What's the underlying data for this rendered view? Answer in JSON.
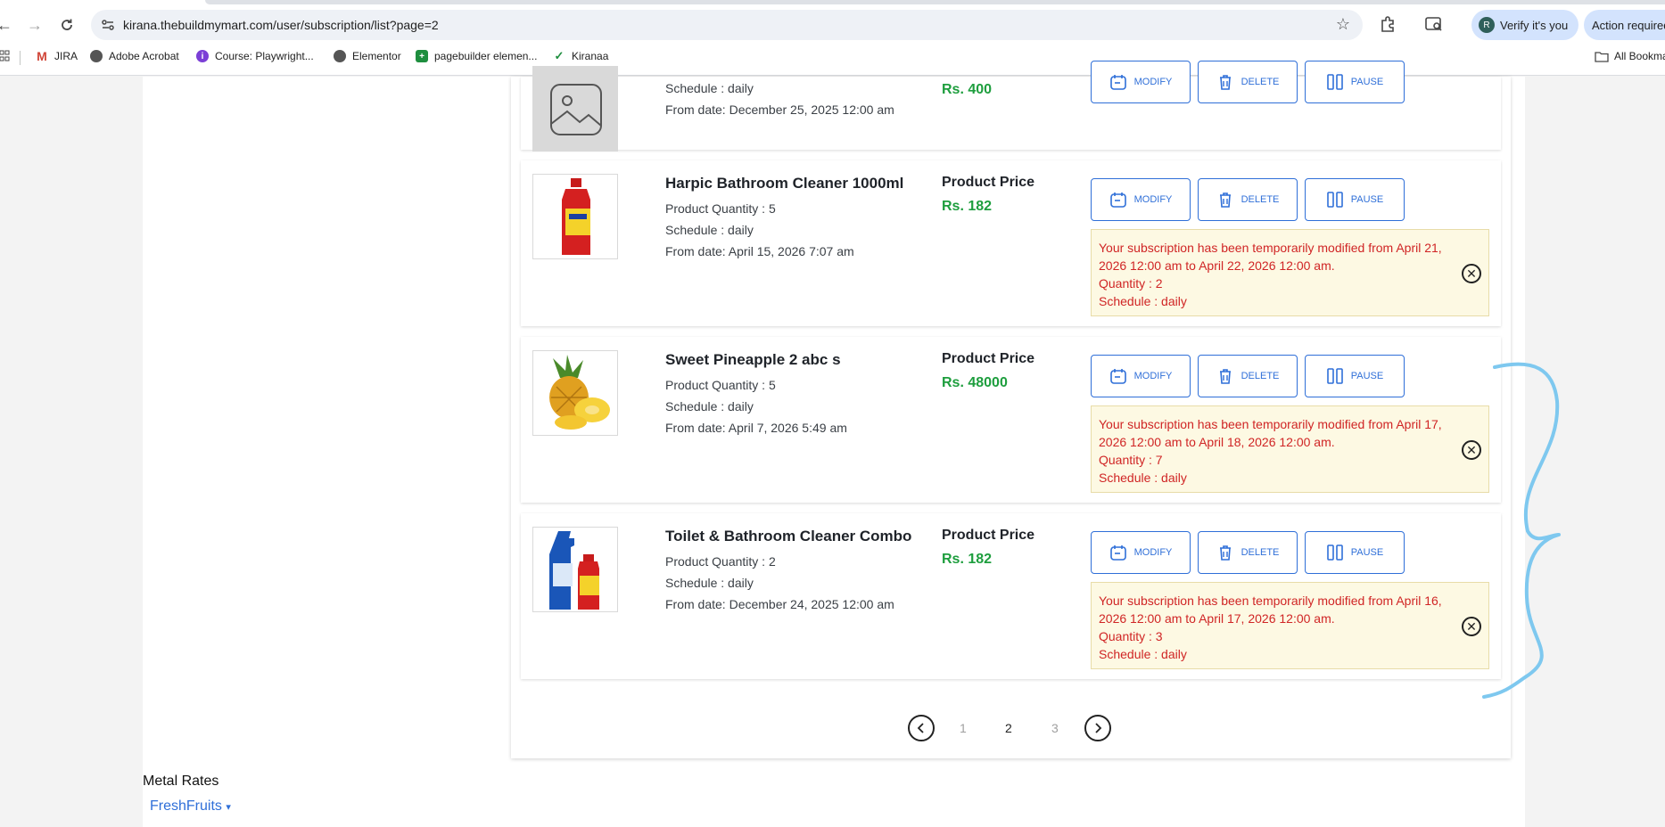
{
  "browser": {
    "url": "kirana.thebuildmymart.com/user/subscription/list?page=2",
    "verify_label": "Verify it's you",
    "verify_avatar": "R",
    "action_label": "Action required",
    "bookmarks": [
      {
        "label": "JIRA",
        "icon": "jira-icon"
      },
      {
        "label": "Adobe Acrobat",
        "icon": "acrobat-icon"
      },
      {
        "label": "Course: Playwright...",
        "icon": "course-icon"
      },
      {
        "label": "Elementor",
        "icon": "elementor-icon"
      },
      {
        "label": "pagebuilder elemen...",
        "icon": "sheets-icon"
      },
      {
        "label": "Kiranaa",
        "icon": "kiranaa-icon"
      }
    ],
    "all_bookmarks": "All Bookmarks"
  },
  "buttons": {
    "modify": "MODIFY",
    "delete": "DELETE",
    "pause": "PAUSE"
  },
  "subscriptions": [
    {
      "name": "",
      "schedule": "Schedule : daily",
      "from_date": "From date: December 25, 2025 12:00 am",
      "price": "Rs. 400",
      "image": "placeholder"
    },
    {
      "name": "Harpic Bathroom Cleaner 1000ml",
      "quantity": "Product Quantity : 5",
      "schedule": "Schedule : daily",
      "from_date": "From date: April 15, 2026 7:07 am",
      "price_label": "Product Price",
      "price": "Rs. 182",
      "notice": {
        "message": "Your subscription has been temporarily modified from April 21, 2026 12:00 am to April 22, 2026 12:00 am.",
        "quantity": "Quantity : 2",
        "schedule": "Schedule : daily"
      }
    },
    {
      "name": "Sweet Pineapple 2 abc s",
      "quantity": "Product Quantity : 5",
      "schedule": "Schedule : daily",
      "from_date": "From date: April 7, 2026 5:49 am",
      "price_label": "Product Price",
      "price": "Rs. 48000",
      "notice": {
        "message": "Your subscription has been temporarily modified from April 17, 2026 12:00 am to April 18, 2026 12:00 am.",
        "quantity": "Quantity : 7",
        "schedule": "Schedule : daily"
      }
    },
    {
      "name": "Toilet & Bathroom Cleaner Combo",
      "quantity": "Product Quantity : 2",
      "schedule": "Schedule : daily",
      "from_date": "From date: December 24, 2025 12:00 am",
      "price_label": "Product Price",
      "price": "Rs. 182",
      "notice": {
        "message": "Your subscription has been temporarily modified from April 16, 2026 12:00 am to April 17, 2026 12:00 am.",
        "quantity": "Quantity : 3",
        "schedule": "Schedule : daily"
      }
    }
  ],
  "pagination": {
    "pages": [
      "1",
      "2",
      "3"
    ],
    "current": "2"
  },
  "footer": {
    "metal_rates": "Metal Rates",
    "freshfruits": "FreshFruits",
    "freshfruits_caret": "▾"
  },
  "colors": {
    "accent": "#2f6fd8",
    "price": "#1e9e3e",
    "notice_text": "#d02525",
    "notice_bg": "#fdf9e3",
    "annotation": "#7ec8ef"
  }
}
